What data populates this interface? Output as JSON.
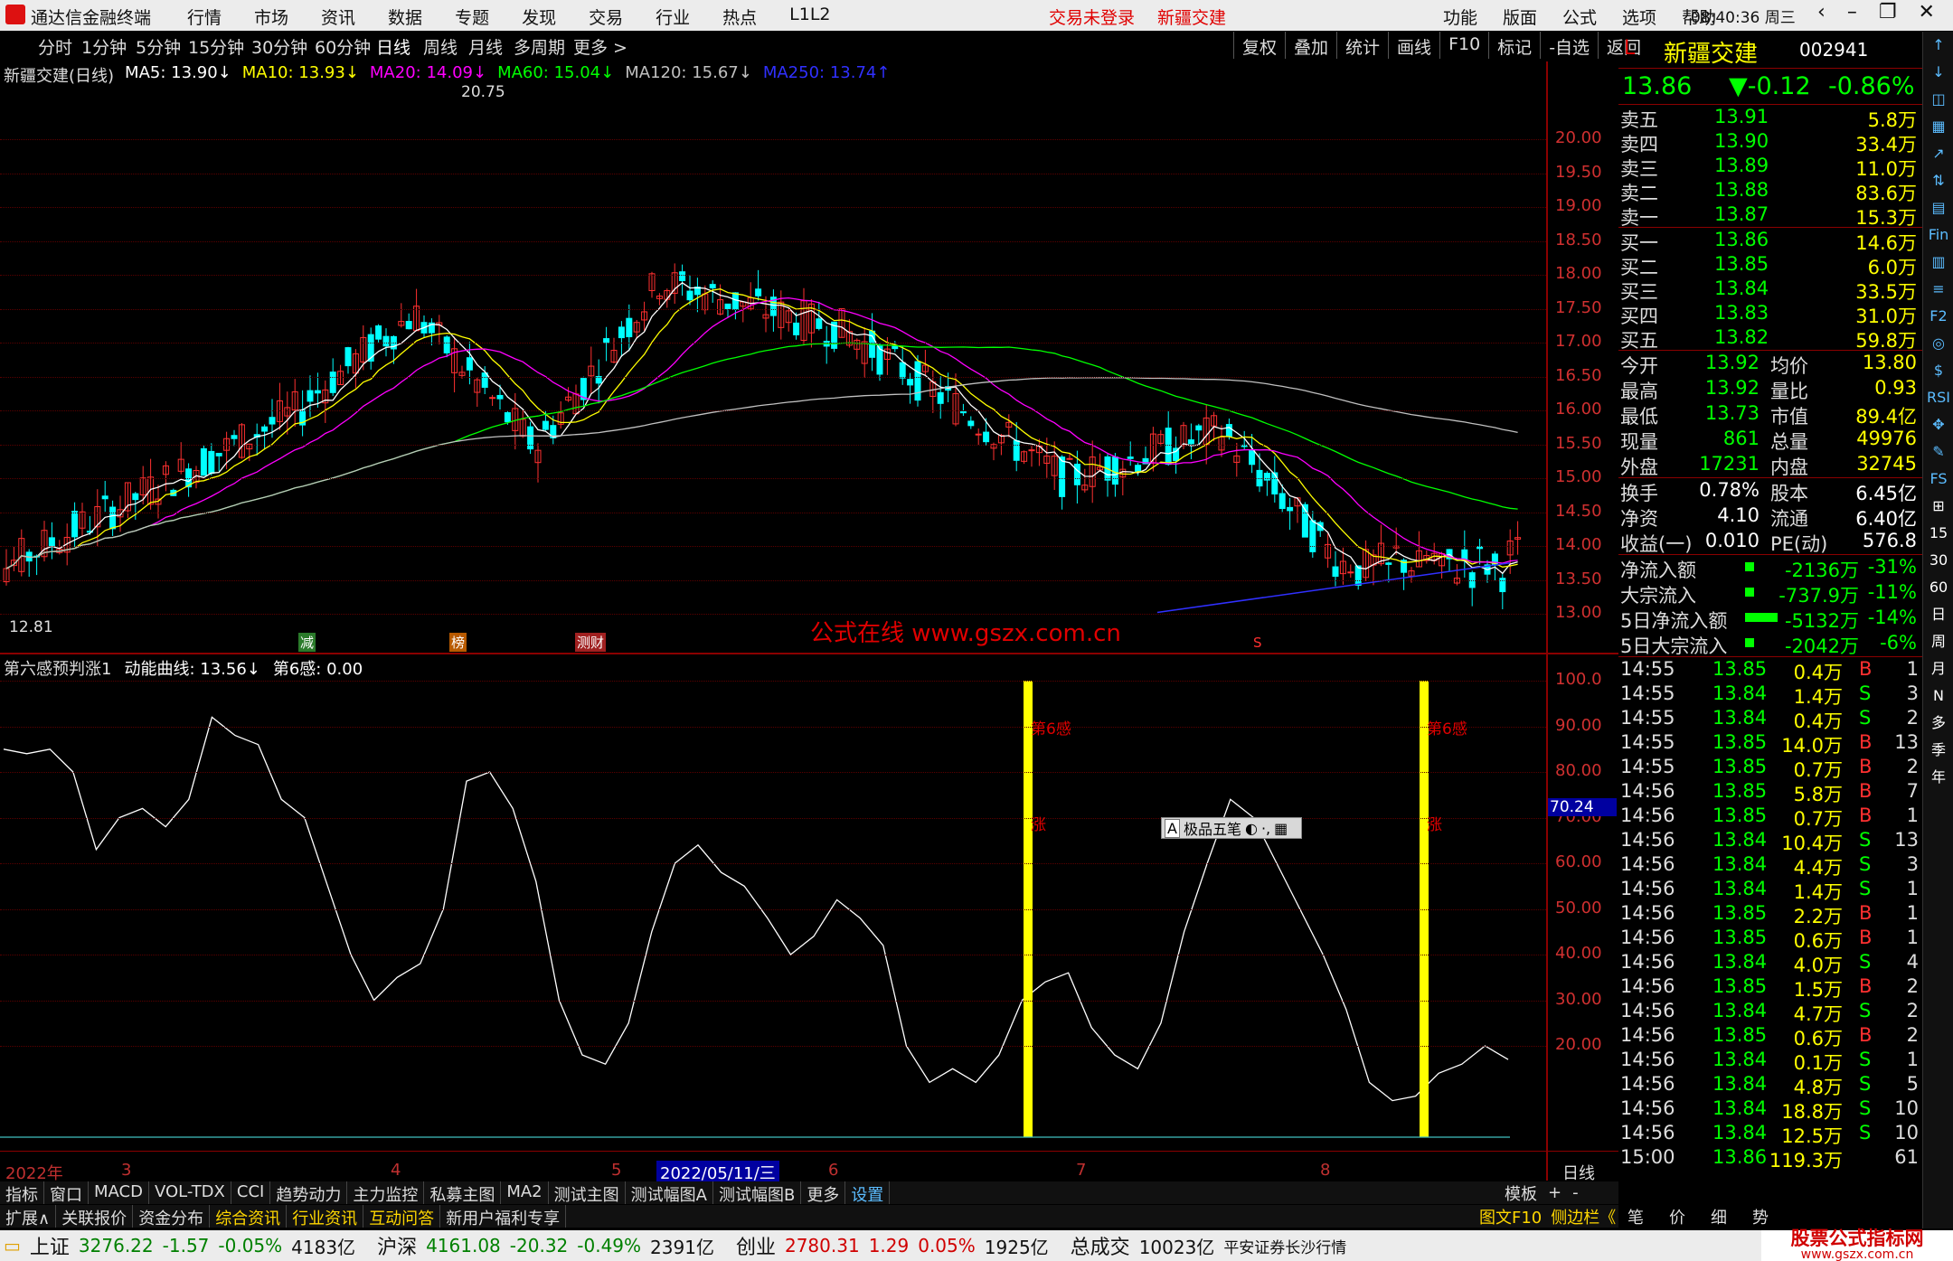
{
  "window": {
    "title": "通达信金融终端",
    "menu": [
      "行情",
      "市场",
      "资讯",
      "数据",
      "专题",
      "发现",
      "交易",
      "行业",
      "热点",
      "L1L2"
    ],
    "login": "交易未登录",
    "stock_title": "新疆交建",
    "right_menu": [
      "功能",
      "版面",
      "公式",
      "选项",
      "帮助"
    ],
    "clock": "08:40:36",
    "weekday": "周三"
  },
  "timeframes": [
    "分时",
    "1分钟",
    "5分钟",
    "15分钟",
    "30分钟",
    "60分钟",
    "日线",
    "周线",
    "月线",
    "多周期",
    "更多 >"
  ],
  "selected_timeframe": "日线",
  "chart_tools": [
    "复权",
    "叠加",
    "统计",
    "画线",
    "F10",
    "标记",
    "-自选",
    "返回"
  ],
  "main_legend": {
    "name": "新疆交建(日线)",
    "ma": [
      {
        "label": "MA5: 13.90↓",
        "color": "#ffffff"
      },
      {
        "label": "MA10: 13.93↓",
        "color": "#ffff00"
      },
      {
        "label": "MA20: 14.09↓",
        "color": "#ff00ff"
      },
      {
        "label": "MA60: 15.04↓",
        "color": "#00ff00"
      },
      {
        "label": "MA120: 15.67↓",
        "color": "#c0c0c0"
      },
      {
        "label": "MA250: 13.74↑",
        "color": "#3030ff"
      }
    ]
  },
  "price_axis": [
    "20.00",
    "19.50",
    "19.00",
    "18.50",
    "18.00",
    "17.50",
    "17.00",
    "16.50",
    "16.00",
    "15.50",
    "15.00",
    "14.50",
    "14.00",
    "13.50",
    "13.00"
  ],
  "high_label": "20.75",
  "low_label": "12.81",
  "event_marks": [
    "减",
    "榜",
    "测财",
    "S"
  ],
  "watermark": "公式在线  www.gszx.com.cn",
  "sub_legend": {
    "name": "第六感预判涨1",
    "line": "动能曲线: 13.56↓",
    "signal": "第6感: 0.00"
  },
  "sub_axis": [
    "100.0",
    "90.00",
    "80.00",
    "70.00",
    "60.00",
    "50.00",
    "40.00",
    "30.00",
    "20.00"
  ],
  "sub_cursor": "70.24",
  "signal_labels": {
    "text": "第6感",
    "rise": "涨"
  },
  "popup": {
    "label": "A",
    "title": "极品五笔"
  },
  "x_axis": {
    "year": "2022年",
    "months": [
      "3",
      "4",
      "5",
      "6",
      "7",
      "8"
    ],
    "cursor_date": "2022/05/11/三",
    "period": "日线"
  },
  "tabs1": [
    "指标",
    "窗口",
    "MACD",
    "VOL-TDX",
    "CCI",
    "趋势动力",
    "主力监控",
    "私募主图",
    "MA2",
    "测试主图",
    "测试幅图A",
    "测试幅图B",
    "更多",
    "设置"
  ],
  "tabs1_right": [
    "模板",
    "+",
    "-"
  ],
  "tabs2": [
    "扩展∧",
    "关联报价",
    "资金分布",
    "综合资讯",
    "行业资讯",
    "互动问答",
    "新用户福利专享"
  ],
  "tabs2_right": [
    "图文F10",
    "侧边栏《",
    "笔",
    "价",
    "细",
    "势"
  ],
  "quote": {
    "flag": "L",
    "name": "新疆交建",
    "code": "002941",
    "price": "13.86",
    "change": "▼-0.12",
    "pct": "-0.86%",
    "asks": [
      {
        "label": "卖五",
        "px": "13.91",
        "vol": "5.8万"
      },
      {
        "label": "卖四",
        "px": "13.90",
        "vol": "33.4万"
      },
      {
        "label": "卖三",
        "px": "13.89",
        "vol": "11.0万"
      },
      {
        "label": "卖二",
        "px": "13.88",
        "vol": "83.6万"
      },
      {
        "label": "卖一",
        "px": "13.87",
        "vol": "15.3万"
      }
    ],
    "bids": [
      {
        "label": "买一",
        "px": "13.86",
        "vol": "14.6万"
      },
      {
        "label": "买二",
        "px": "13.85",
        "vol": "6.0万"
      },
      {
        "label": "买三",
        "px": "13.84",
        "vol": "33.5万"
      },
      {
        "label": "买四",
        "px": "13.83",
        "vol": "31.0万"
      },
      {
        "label": "买五",
        "px": "13.82",
        "vol": "59.8万"
      }
    ],
    "stats": [
      [
        "今开",
        "13.92",
        "均价",
        "13.80"
      ],
      [
        "最高",
        "13.92",
        "量比",
        "0.93"
      ],
      [
        "最低",
        "13.73",
        "市值",
        "89.4亿"
      ],
      [
        "现量",
        "861",
        "总量",
        "49976"
      ],
      [
        "外盘",
        "17231",
        "内盘",
        "32745"
      ]
    ],
    "stats2": [
      [
        "换手",
        "0.78%",
        "股本",
        "6.45亿"
      ],
      [
        "净资",
        "4.10",
        "流通",
        "6.40亿"
      ],
      [
        "收益(一)",
        "0.010",
        "PE(动)",
        "576.8"
      ]
    ],
    "flows": [
      [
        "净流入额",
        "-2136万",
        "-31%"
      ],
      [
        "大宗流入",
        "-737.9万",
        "-11%"
      ],
      [
        "5日净流入额",
        "-5132万",
        "-14%"
      ],
      [
        "5日大宗流入",
        "-2042万",
        "-6%"
      ]
    ],
    "ticks": [
      [
        "14:55",
        "13.85",
        "0.4万",
        "B",
        "1"
      ],
      [
        "14:55",
        "13.84",
        "1.4万",
        "S",
        "3"
      ],
      [
        "14:55",
        "13.84",
        "0.4万",
        "S",
        "2"
      ],
      [
        "14:55",
        "13.85",
        "14.0万",
        "B",
        "13"
      ],
      [
        "14:55",
        "13.85",
        "0.7万",
        "B",
        "2"
      ],
      [
        "14:56",
        "13.85",
        "5.8万",
        "B",
        "7"
      ],
      [
        "14:56",
        "13.85",
        "0.7万",
        "B",
        "1"
      ],
      [
        "14:56",
        "13.84",
        "10.4万",
        "S",
        "13"
      ],
      [
        "14:56",
        "13.84",
        "4.4万",
        "S",
        "3"
      ],
      [
        "14:56",
        "13.84",
        "1.4万",
        "S",
        "1"
      ],
      [
        "14:56",
        "13.85",
        "2.2万",
        "B",
        "1"
      ],
      [
        "14:56",
        "13.85",
        "0.6万",
        "B",
        "1"
      ],
      [
        "14:56",
        "13.84",
        "4.0万",
        "S",
        "4"
      ],
      [
        "14:56",
        "13.85",
        "1.5万",
        "B",
        "2"
      ],
      [
        "14:56",
        "13.84",
        "4.7万",
        "S",
        "2"
      ],
      [
        "14:56",
        "13.85",
        "0.6万",
        "B",
        "2"
      ],
      [
        "14:56",
        "13.84",
        "0.1万",
        "S",
        "1"
      ],
      [
        "14:56",
        "13.84",
        "4.8万",
        "S",
        "5"
      ],
      [
        "14:56",
        "13.84",
        "18.8万",
        "S",
        "10"
      ],
      [
        "14:56",
        "13.84",
        "12.5万",
        "S",
        "10"
      ],
      [
        "15:00",
        "13.86",
        "119.3万",
        "",
        "61"
      ]
    ]
  },
  "side_tools": [
    "↑",
    "↓",
    "◫",
    "▦",
    "↗",
    "⇅",
    "▤",
    "Fin",
    "▥",
    "≡",
    "F2",
    "◎",
    "$",
    "RSI",
    "✥",
    "✎",
    "FS",
    "⊞",
    "15",
    "30",
    "60",
    "日",
    "周",
    "月",
    "N",
    "多",
    "季",
    "年"
  ],
  "status": {
    "indices": [
      {
        "name": "上证",
        "v": "3276.22",
        "c": "-1.57",
        "p": "-0.05%",
        "amt": "4183亿"
      },
      {
        "name": "沪深",
        "v": "4161.08",
        "c": "-20.32",
        "p": "-0.49%",
        "amt": "2391亿"
      },
      {
        "name": "创业",
        "v": "2780.31",
        "c": "1.29",
        "p": "0.05%",
        "amt": "1925亿"
      }
    ],
    "total_label": "总成交",
    "total": "10023亿",
    "broker": "平安证券长沙行情",
    "brand": "股票公式指标网",
    "brand_url": "www.gszx.com.cn"
  },
  "colors": {
    "up": "#ff3030",
    "down": "#00ffff",
    "ma5": "#ffffff",
    "ma10": "#ffff00",
    "ma20": "#ff00ff",
    "ma60": "#00ff00",
    "ma120": "#c0c0c0",
    "ma250": "#3030ff"
  }
}
